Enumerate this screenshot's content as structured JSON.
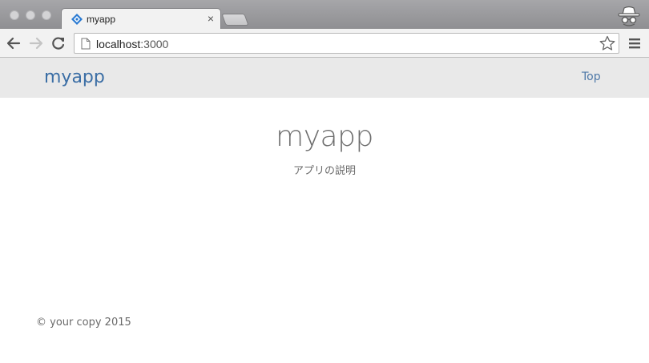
{
  "browser": {
    "tab": {
      "title": "myapp",
      "close_glyph": "×",
      "favicon": "blue-diamond-favicon-icon"
    },
    "address_bar": {
      "host": "localhost",
      "port": ":3000"
    },
    "icons": {
      "back": "back-arrow-icon",
      "forward": "forward-arrow-icon",
      "reload": "reload-icon",
      "page": "page-icon",
      "bookmark": "star-icon",
      "menu": "hamburger-menu-icon",
      "incognito": "incognito-icon"
    }
  },
  "page": {
    "navbar": {
      "brand": "myapp",
      "links": [
        {
          "label": "Top"
        }
      ]
    },
    "hero": {
      "title": "myapp",
      "subtitle": "アプリの説明"
    },
    "footer": {
      "copyright": "© your copy 2015"
    }
  },
  "colors": {
    "brand": "#3b6ea5",
    "navbar_bg": "#e9e9e9",
    "text_muted": "#6a6a6a"
  }
}
